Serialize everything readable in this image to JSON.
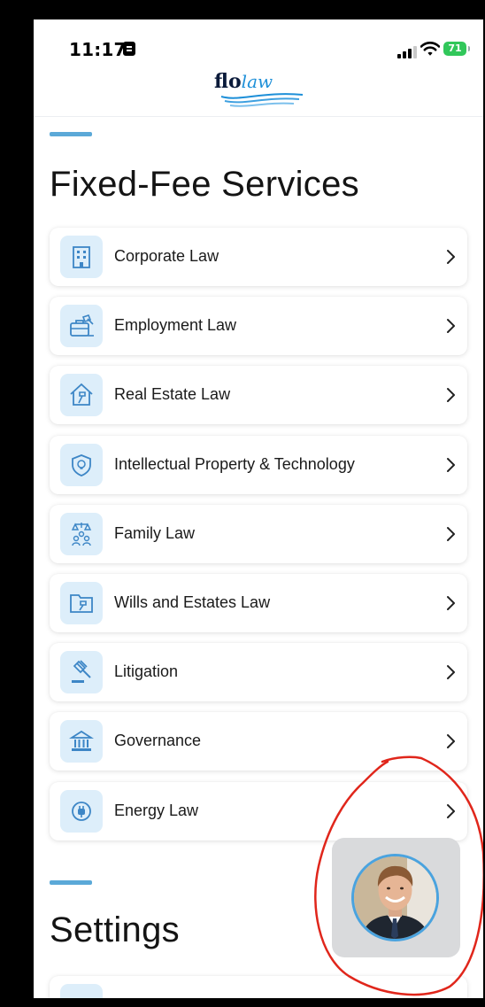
{
  "status_bar": {
    "time": "11:17",
    "battery": "71"
  },
  "logo": {
    "text_bold": "flo",
    "text_script": "law"
  },
  "services_section": {
    "title": "Fixed-Fee Services",
    "items": [
      {
        "label": "Corporate Law",
        "icon": "building-icon"
      },
      {
        "label": "Employment Law",
        "icon": "briefcase-gavel-icon"
      },
      {
        "label": "Real Estate Law",
        "icon": "house-gavel-icon"
      },
      {
        "label": "Intellectual Property & Technology",
        "icon": "shield-bulb-icon"
      },
      {
        "label": "Family Law",
        "icon": "scales-family-icon"
      },
      {
        "label": "Wills and Estates Law",
        "icon": "folder-gavel-icon"
      },
      {
        "label": "Litigation",
        "icon": "gavel-icon"
      },
      {
        "label": "Governance",
        "icon": "courthouse-icon"
      },
      {
        "label": "Energy Law",
        "icon": "plug-icon"
      }
    ]
  },
  "settings_section": {
    "title": "Settings"
  },
  "colors": {
    "accent": "#5ba9d8",
    "icon_bg": "#ddeefa",
    "icon_stroke": "#3d86c6",
    "annotation": "#e0261b"
  }
}
